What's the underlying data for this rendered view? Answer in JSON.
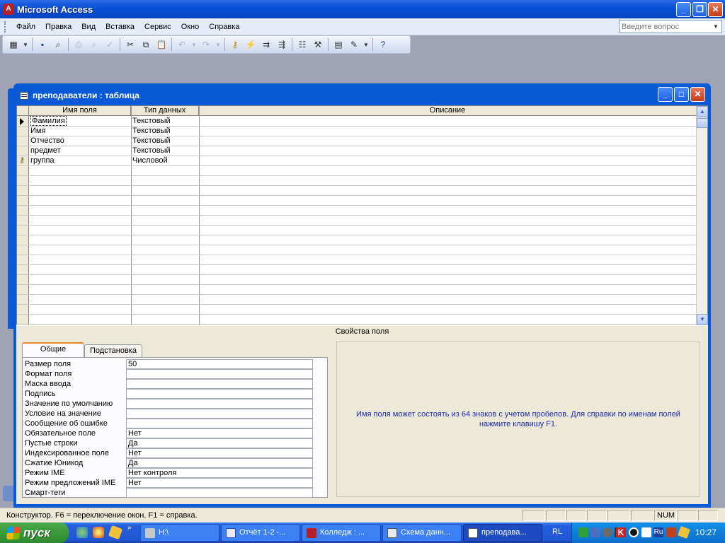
{
  "app": {
    "title": "Microsoft Access",
    "menu": [
      "Файл",
      "Правка",
      "Вид",
      "Вставка",
      "Сервис",
      "Окно",
      "Справка"
    ],
    "ask_placeholder": "Введите вопрос"
  },
  "toolbar_icons": [
    "view-icon",
    "dropdown-icon",
    "save-icon",
    "search-file-icon",
    "print-icon",
    "print-preview-icon",
    "spellcheck-icon",
    "cut-icon",
    "copy-icon",
    "paste-icon",
    "undo-icon",
    "undo-dropdown-icon",
    "redo-icon",
    "redo-dropdown-icon",
    "key-icon",
    "index-icon",
    "insert-rows-icon",
    "delete-rows-icon",
    "properties-icon",
    "build-icon",
    "database-window-icon",
    "new-object-icon",
    "new-object-dropdown-icon",
    "help-icon"
  ],
  "table_window": {
    "title": "преподаватели : таблица",
    "columns": [
      "Имя поля",
      "Тип данных",
      "Описание"
    ],
    "rows": [
      {
        "name": "Фамилия",
        "type": "Текстовый",
        "marker": "current"
      },
      {
        "name": "Имя",
        "type": "Текстовый",
        "marker": ""
      },
      {
        "name": "Отчество",
        "type": "Текстовый",
        "marker": ""
      },
      {
        "name": "предмет",
        "type": "Текстовый",
        "marker": ""
      },
      {
        "name": "группа",
        "type": "Числовой",
        "marker": "key"
      }
    ]
  },
  "field_properties": {
    "header": "Свойства поля",
    "tabs": [
      "Общие",
      "Подстановка"
    ],
    "active_tab": "Общие",
    "properties": [
      {
        "label": "Размер поля",
        "value": "50"
      },
      {
        "label": "Формат поля",
        "value": ""
      },
      {
        "label": "Маска ввода",
        "value": ""
      },
      {
        "label": "Подпись",
        "value": ""
      },
      {
        "label": "Значение по умолчанию",
        "value": ""
      },
      {
        "label": "Условие на значение",
        "value": ""
      },
      {
        "label": "Сообщение об ошибке",
        "value": ""
      },
      {
        "label": "Обязательное поле",
        "value": "Нет"
      },
      {
        "label": "Пустые строки",
        "value": "Да"
      },
      {
        "label": "Индексированное поле",
        "value": "Нет"
      },
      {
        "label": "Сжатие Юникод",
        "value": "Да"
      },
      {
        "label": "Режим IME",
        "value": "Нет контроля"
      },
      {
        "label": "Режим предложений IME",
        "value": "Нет"
      },
      {
        "label": "Смарт-теги",
        "value": ""
      }
    ],
    "help_text": "Имя поля может состоять из 64 знаков с учетом пробелов.  Для справки по именам полей нажмите клавишу F1."
  },
  "statusbar": {
    "text": "Конструктор.  F6 = переключение окон.  F1 = справка.",
    "num": "NUM"
  },
  "taskbar": {
    "start": "пуск",
    "tasks": [
      {
        "label": "H:\\",
        "icon": "drive-icon"
      },
      {
        "label": "Отчёт 1-2 -...",
        "icon": "word-icon"
      },
      {
        "label": "Колледж : ...",
        "icon": "access-db-icon"
      },
      {
        "label": "Схема данн...",
        "icon": "relationships-icon"
      },
      {
        "label": "преподава...",
        "icon": "table-icon"
      }
    ],
    "lang": "RL",
    "clock": "10:27"
  }
}
